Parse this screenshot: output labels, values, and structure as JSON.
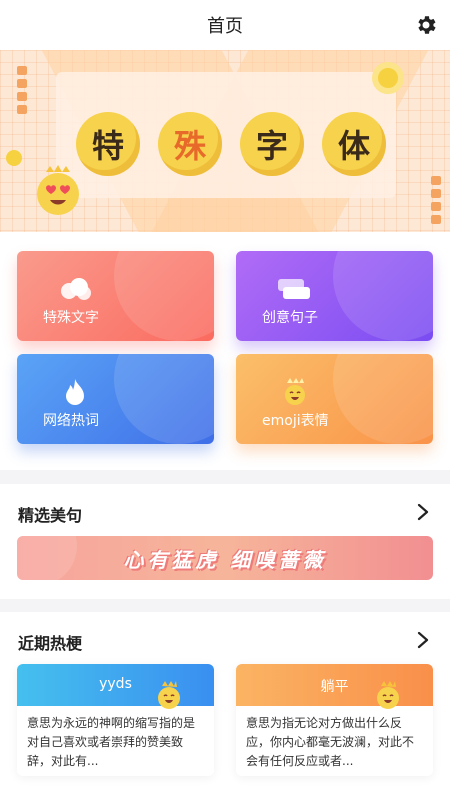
{
  "header": {
    "title": "首页",
    "settings_icon": "gear-icon"
  },
  "banner": {
    "glyphs": [
      "特",
      "殊",
      "字",
      "体"
    ]
  },
  "tiles": [
    {
      "label": "特殊文字",
      "icon": "cloud-icon",
      "color": "#fb6a5f"
    },
    {
      "label": "创意句子",
      "icon": "cards-icon",
      "color": "#7a4cf2"
    },
    {
      "label": "网络热词",
      "icon": "flame-icon",
      "color": "#3f6ee8"
    },
    {
      "label": "emoji表情",
      "icon": "smiley-crown-icon",
      "color": "#f99248"
    }
  ],
  "featured": {
    "title": "精选美句",
    "quote": "心有猛虎 细嗅蔷薇"
  },
  "hot": {
    "title": "近期热梗",
    "cards": [
      {
        "term": "yyds",
        "desc": "意思为永远的神啊的缩写指的是对自己喜欢或者崇拜的赞美致辞，对此有..."
      },
      {
        "term": "躺平",
        "desc": "意思为指无论对方做出什么反应，你内心都毫无波澜，对此不会有任何反应或者..."
      }
    ]
  }
}
